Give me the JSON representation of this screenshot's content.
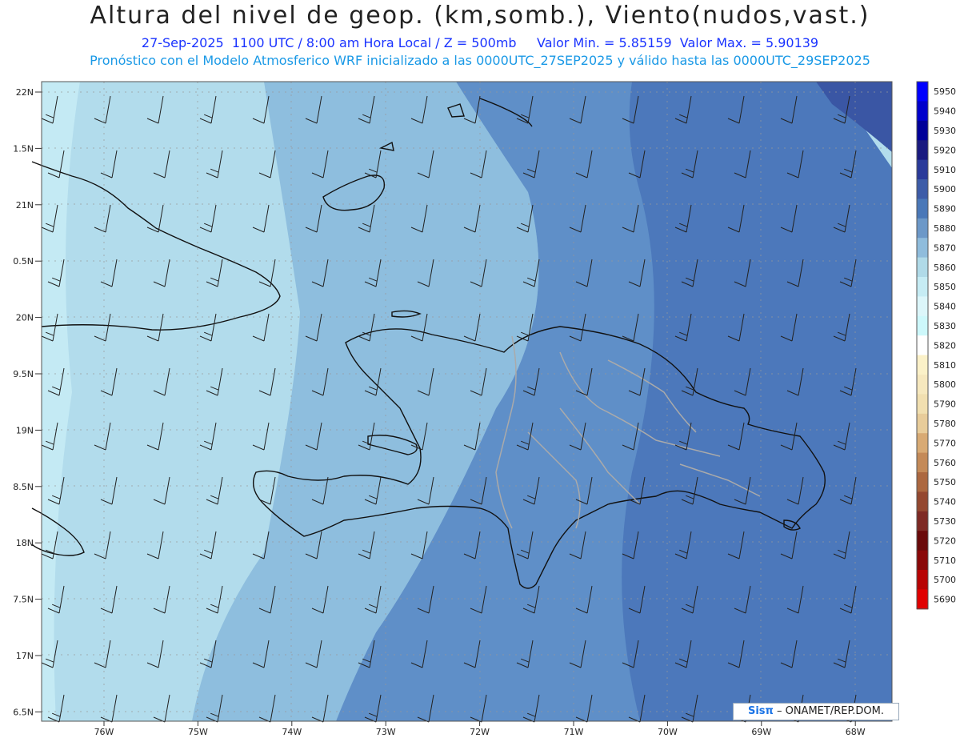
{
  "header": {
    "title": "Altura del nivel de geop. (km,somb.), Viento(nudos,vast.)",
    "date": "27-Sep-2025",
    "time_info": "1100 UTC / 8:00 am Hora Local / Z = 500mb",
    "min_value": "Valor Min. = 5.85159",
    "max_value": "Valor Max. = 5.90139",
    "model_line": "Pronóstico con el Modelo Atmosferico WRF inicializado a las 0000UTC_27SEP2025 y válido hasta las  0000UTC_29SEP2025"
  },
  "axes": {
    "lat_labels": [
      "22N",
      "1.5N",
      "21N",
      "0.5N",
      "20N",
      "9.5N",
      "19N",
      "8.5N",
      "18N",
      "7.5N",
      "17N",
      "6.5N"
    ],
    "lon_labels": [
      "76W",
      "75W",
      "74W",
      "73W",
      "72W",
      "71W",
      "70W",
      "69W",
      "68W"
    ]
  },
  "colorbar": {
    "levels": [
      "5950",
      "5940",
      "5930",
      "5920",
      "5910",
      "5900",
      "5890",
      "5880",
      "5870",
      "5860",
      "5850",
      "5840",
      "5830",
      "5820",
      "5810",
      "5800",
      "5790",
      "5780",
      "5770",
      "5760",
      "5750",
      "5740",
      "5730",
      "5720",
      "5710",
      "5700",
      "5690"
    ],
    "colors": [
      "#0000ff",
      "#0000cc",
      "#000099",
      "#1a1a80",
      "#2a3a9a",
      "#3d5ca8",
      "#4a78b8",
      "#6c98c8",
      "#8fbcdc",
      "#b0dae8",
      "#c6ecf4",
      "#dcf6fa",
      "#cdf8fb",
      "#ffffff",
      "#fbf1c8",
      "#f6e8be",
      "#f1dfb0",
      "#e8cc9a",
      "#d8aa74",
      "#c48a58",
      "#ac6840",
      "#944830",
      "#7e2a24",
      "#6a0a0a",
      "#8a0808",
      "#b80404",
      "#e00000"
    ]
  },
  "footer": {
    "logo": "Sisπ",
    "credit": "– ONAMET/REP.DOM."
  }
}
